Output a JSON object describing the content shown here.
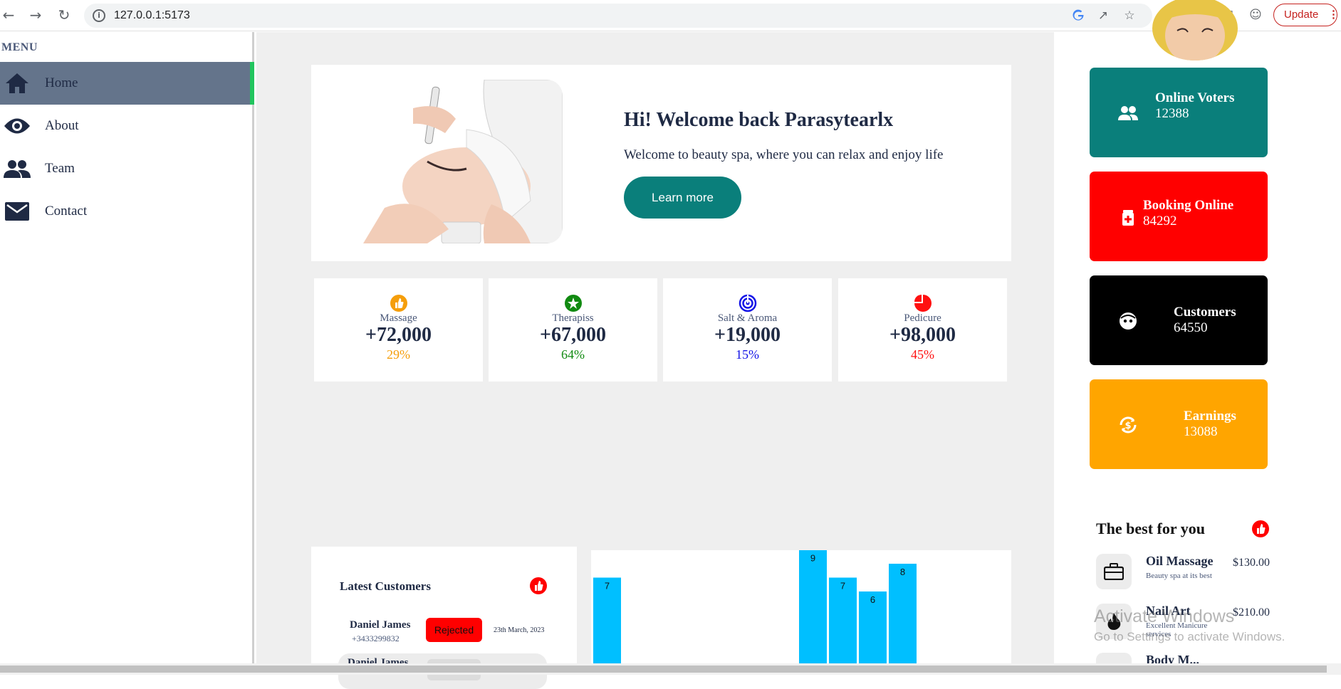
{
  "browser": {
    "url": "127.0.0.1:5173",
    "update_label": "Update"
  },
  "sidebar": {
    "menu_title": "MENU",
    "items": [
      {
        "label": "Home",
        "icon": "home-icon",
        "active": true
      },
      {
        "label": "About",
        "icon": "eye-icon",
        "active": false
      },
      {
        "label": "Team",
        "icon": "team-icon",
        "active": false
      },
      {
        "label": "Contact",
        "icon": "mail-icon",
        "active": false
      }
    ]
  },
  "welcome": {
    "title": "Hi! Welcome back Parasytearlx",
    "text": "Welcome to beauty spa, where you can relax and enjoy life",
    "button_label": "Learn more"
  },
  "stats": [
    {
      "label": "Massage",
      "value": "+72,000",
      "percent": "29%",
      "color": "#f59e0b",
      "icon": "thumbs-up-icon"
    },
    {
      "label": "Therapiss",
      "value": "+67,000",
      "percent": "64%",
      "color": "#118a11",
      "icon": "star-icon"
    },
    {
      "label": "Salt & Aroma",
      "value": "+19,000",
      "percent": "15%",
      "color": "#1414e6",
      "icon": "target-icon"
    },
    {
      "label": "Pedicure",
      "value": "+98,000",
      "percent": "45%",
      "color": "#ff1010",
      "icon": "pie-icon"
    }
  ],
  "latest_customers": {
    "title": "Latest Customers",
    "rows": [
      {
        "name": "Daniel James",
        "phone": "+3433299832",
        "status": "Rejected",
        "date": "23th March, 2023"
      },
      {
        "name": "Daniel James",
        "phone": "",
        "status": "",
        "date": ""
      }
    ]
  },
  "chart_data": {
    "type": "bar",
    "values": [
      7,
      9,
      7,
      6,
      8
    ],
    "data_labels": [
      "7",
      "9",
      "7",
      "6",
      "8"
    ],
    "bar_color": "#00bfff"
  },
  "kpis": [
    {
      "label": "Online Voters",
      "value": "12388",
      "color": "#0a7f7b",
      "icon": "users-icon"
    },
    {
      "label": "Booking Online",
      "value": "84292",
      "color": "#ff0000",
      "icon": "medical-kit-icon"
    },
    {
      "label": "Customers",
      "value": "64550",
      "color": "#000000",
      "icon": "face-icon"
    },
    {
      "label": "Earnings",
      "value": "13088",
      "color": "#ffa500",
      "icon": "dollar-refresh-icon"
    }
  ],
  "best_for_you": {
    "title": "The best for you",
    "items": [
      {
        "name": "Oil Massage",
        "desc": "Beauty spa at its best",
        "price": "$130.00",
        "icon": "briefcase-icon"
      },
      {
        "name": "Nail Art",
        "desc": "Excellent Manicure services",
        "price": "$210.00",
        "icon": "flame-icon"
      },
      {
        "name": "Body M...",
        "desc": "",
        "price": "",
        "icon": "spa-icon"
      }
    ]
  },
  "watermark": {
    "line1": "Activate Windows",
    "line2": "Go to Settings to activate Windows."
  }
}
